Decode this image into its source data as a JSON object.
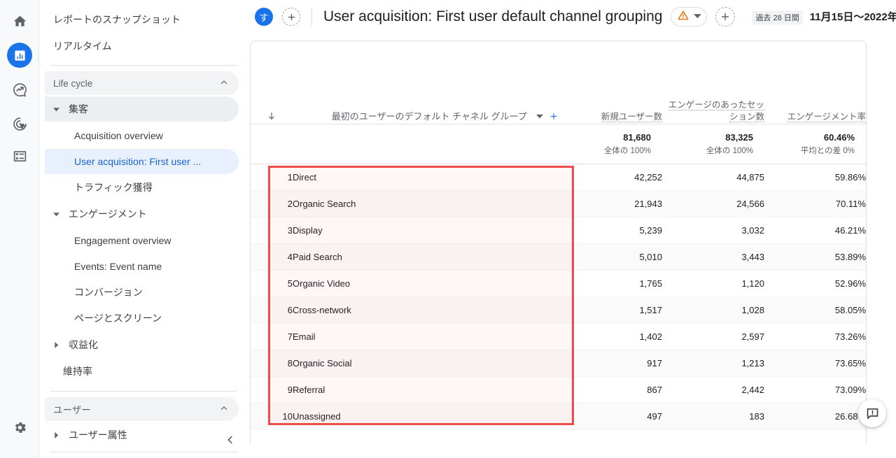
{
  "rail": {
    "items": [
      {
        "name": "home",
        "label": "ホーム"
      },
      {
        "name": "reports",
        "label": "レポート"
      },
      {
        "name": "explore",
        "label": "探索"
      },
      {
        "name": "advertising",
        "label": "広告"
      },
      {
        "name": "library",
        "label": "ライブラリ"
      }
    ],
    "settings_label": "管理"
  },
  "sidebar": {
    "top_items": [
      {
        "label": "レポートのスナップショット"
      },
      {
        "label": "リアルタイム"
      }
    ],
    "sections": [
      {
        "label": "Life cycle",
        "collapse_icon": "chevron-up-icon",
        "groups": [
          {
            "label": "集客",
            "expanded": true,
            "children": [
              {
                "label": "Acquisition overview",
                "selected": false
              },
              {
                "label": "User acquisition: First user ...",
                "selected": true
              },
              {
                "label": "トラフィック獲得",
                "selected": false
              }
            ]
          },
          {
            "label": "エンゲージメント",
            "expanded": true,
            "children": [
              {
                "label": "Engagement overview",
                "selected": false
              },
              {
                "label": "Events: Event name",
                "selected": false
              },
              {
                "label": "コンバージョン",
                "selected": false
              },
              {
                "label": "ページとスクリーン",
                "selected": false
              }
            ]
          },
          {
            "label": "収益化",
            "expanded": false,
            "children": []
          }
        ],
        "plain_items": [
          {
            "label": "維持率"
          }
        ]
      },
      {
        "label": "ユーザー",
        "collapse_icon": "chevron-up-icon",
        "groups": [
          {
            "label": "ユーザー属性",
            "expanded": false,
            "children": []
          }
        ],
        "plain_items": []
      }
    ],
    "collapse_button_icon": "chevron-left-icon"
  },
  "topbar": {
    "account_badge": "す",
    "add_account_icon": "plus-icon",
    "title": "User acquisition: First user default channel grouping",
    "warning_icon": "warning-triangle-icon",
    "warning_dropdown_icon": "chevron-down-icon",
    "add_comparison_icon": "plus-icon",
    "date_preset": "過去 28 日間",
    "date_range": "11月15日〜2022年1"
  },
  "table": {
    "dimension_header": "最初のユーザーのデフォルト チャネル グループ",
    "dimension_dropdown_icon": "chevron-down-icon",
    "add_dimension_icon": "plus-icon",
    "sort_icon": "arrow-down-icon",
    "metrics": [
      {
        "label": "新規ユーザー数",
        "total": "81,680",
        "subtotal": "全体の 100%"
      },
      {
        "label": "エンゲージのあったセッション数",
        "total": "83,325",
        "subtotal": "全体の 100%"
      },
      {
        "label": "エンゲージメント率",
        "total": "60.46%",
        "subtotal": "平均との差 0%"
      }
    ],
    "rows": [
      {
        "rank": "1",
        "dimension": "Direct",
        "new_users": "42,252",
        "engaged_sessions": "44,875",
        "engagement_rate": "59.86%"
      },
      {
        "rank": "2",
        "dimension": "Organic Search",
        "new_users": "21,943",
        "engaged_sessions": "24,566",
        "engagement_rate": "70.11%"
      },
      {
        "rank": "3",
        "dimension": "Display",
        "new_users": "5,239",
        "engaged_sessions": "3,032",
        "engagement_rate": "46.21%"
      },
      {
        "rank": "4",
        "dimension": "Paid Search",
        "new_users": "5,010",
        "engaged_sessions": "3,443",
        "engagement_rate": "53.89%"
      },
      {
        "rank": "5",
        "dimension": "Organic Video",
        "new_users": "1,765",
        "engaged_sessions": "1,120",
        "engagement_rate": "52.96%"
      },
      {
        "rank": "6",
        "dimension": "Cross-network",
        "new_users": "1,517",
        "engaged_sessions": "1,028",
        "engagement_rate": "58.05%"
      },
      {
        "rank": "7",
        "dimension": "Email",
        "new_users": "1,402",
        "engaged_sessions": "2,597",
        "engagement_rate": "73.26%"
      },
      {
        "rank": "8",
        "dimension": "Organic Social",
        "new_users": "917",
        "engaged_sessions": "1,213",
        "engagement_rate": "73.65%"
      },
      {
        "rank": "9",
        "dimension": "Referral",
        "new_users": "867",
        "engaged_sessions": "2,442",
        "engagement_rate": "73.09%"
      },
      {
        "rank": "10",
        "dimension": "Unassigned",
        "new_users": "497",
        "engaged_sessions": "183",
        "engagement_rate": "26.68%"
      }
    ]
  },
  "annotation": {
    "color": "#f04b4b",
    "target": "dimension-rows-region"
  },
  "feedback": {
    "icon": "feedback-speech-bubble-icon"
  }
}
